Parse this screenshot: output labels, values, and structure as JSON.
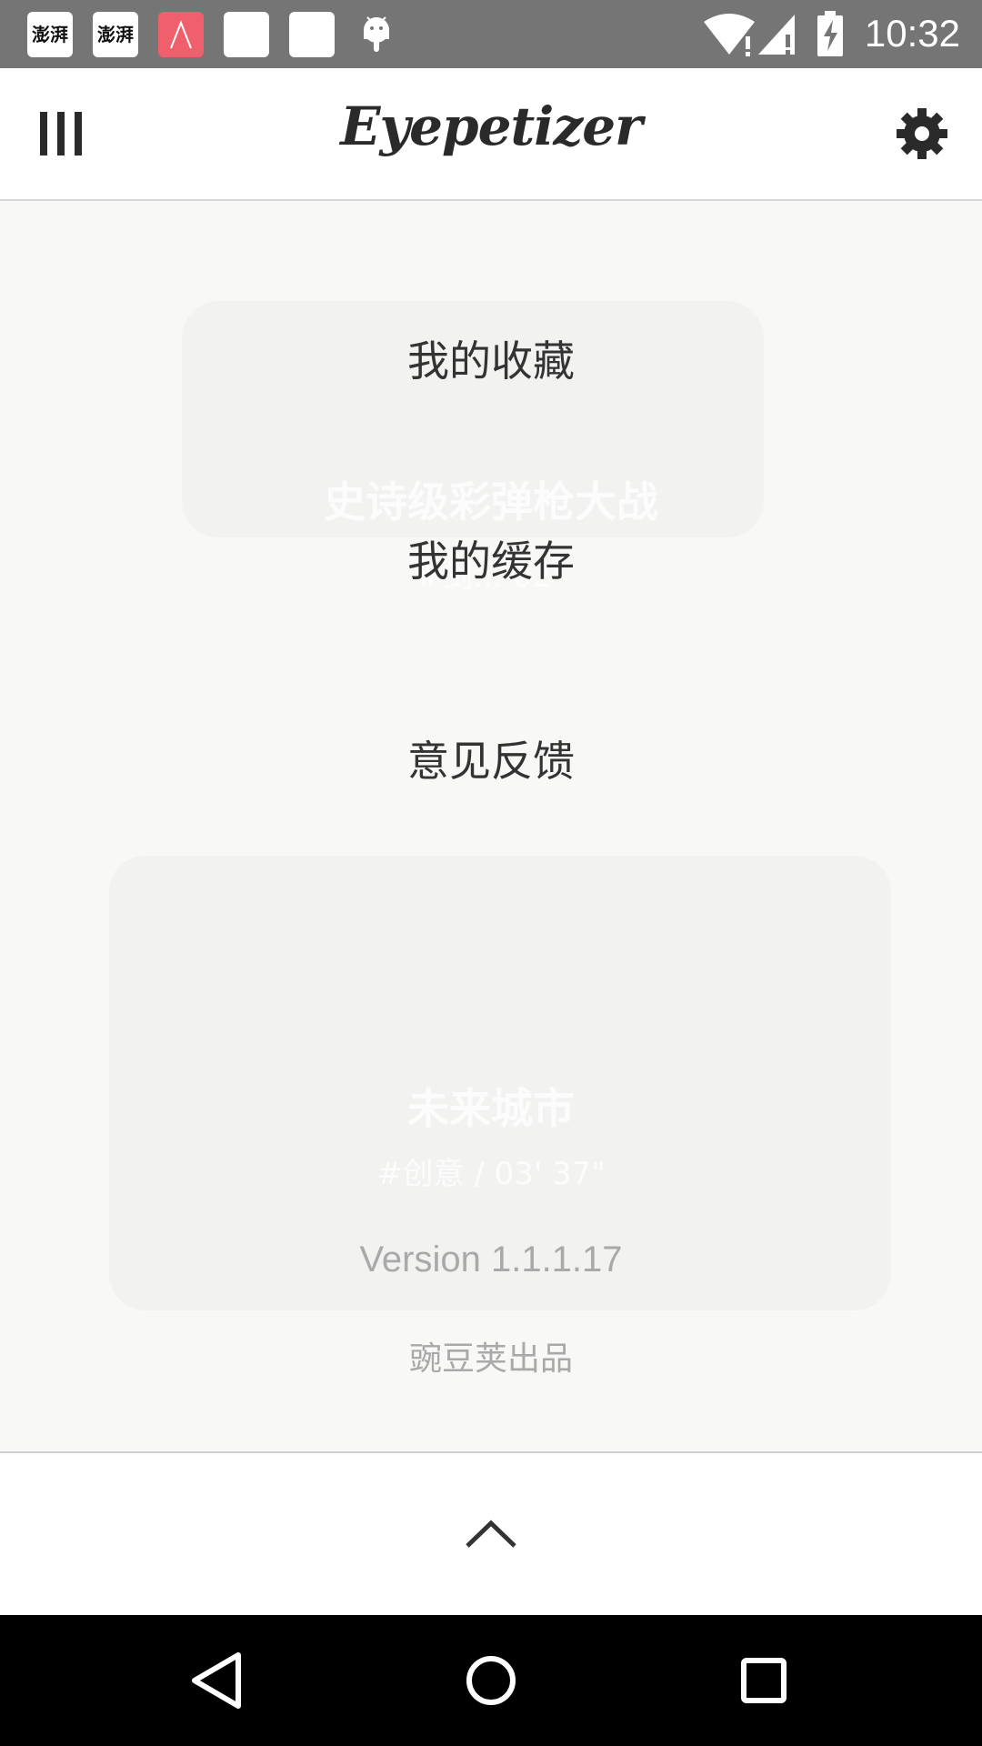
{
  "status_bar": {
    "notifications": [
      {
        "icon": "news-app-icon",
        "text": "澎湃"
      },
      {
        "icon": "news-app-icon",
        "text": "澎湃"
      },
      {
        "icon": "red-app-icon"
      },
      {
        "icon": "white-app-icon"
      },
      {
        "icon": "white-app-icon"
      },
      {
        "icon": "android-debug-icon"
      }
    ],
    "time": "10:32",
    "icons": [
      "wifi-icon",
      "signal-icon",
      "battery-charging-icon"
    ]
  },
  "header": {
    "logo": "Eyepetizer",
    "menu_icon": "menu-icon",
    "settings_icon": "gear-icon"
  },
  "drawer": {
    "items": [
      {
        "label": "我的收藏"
      },
      {
        "label": "我的缓存"
      },
      {
        "label": "意见反馈"
      }
    ],
    "background_text": {
      "title1": "史诗级彩弹枪大战",
      "sub1": "#剑... 02\"",
      "title2": "未来城市",
      "sub2": "#创意 / 03' 37\""
    },
    "version": "Version 1.1.1.17",
    "producer": "豌豆荚出品"
  },
  "collapse_icon": "chevron-up-icon",
  "nav": {
    "back_icon": "back-icon",
    "home_icon": "home-icon",
    "recents_icon": "recents-icon"
  },
  "colors": {
    "status_bar": "#757575",
    "drawer_bg": "#f8f8f7",
    "menu_text": "#333333",
    "secondary_text": "#a9a9a9"
  }
}
